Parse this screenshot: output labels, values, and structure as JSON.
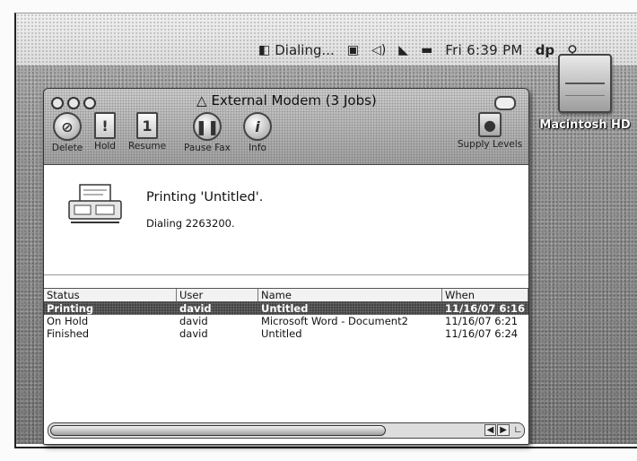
{
  "menubar": {
    "fax_status": "Dialing...",
    "time": "Fri 6:39 PM",
    "user": "dp"
  },
  "desktop": {
    "disk_label": "Macintosh HD"
  },
  "window": {
    "title": "External Modem (3 Jobs)",
    "toolbar": {
      "delete": "Delete",
      "hold": "Hold",
      "resume": "Resume",
      "pause_fax": "Pause Fax",
      "info": "Info",
      "supply_levels": "Supply Levels"
    },
    "current_job": {
      "title": "Printing 'Untitled'.",
      "detail": "Dialing 2263200."
    },
    "table": {
      "headers": [
        "Status",
        "User",
        "Name",
        "When"
      ],
      "rows": [
        {
          "status": "Printing",
          "user": "david",
          "name": "Untitled",
          "when": "11/16/07 6:16"
        },
        {
          "status": "On Hold",
          "user": "david",
          "name": "Microsoft Word - Document2",
          "when": "11/16/07 6:21"
        },
        {
          "status": "Finished",
          "user": "david",
          "name": "Untitled",
          "when": "11/16/07 6:24"
        }
      ]
    }
  }
}
